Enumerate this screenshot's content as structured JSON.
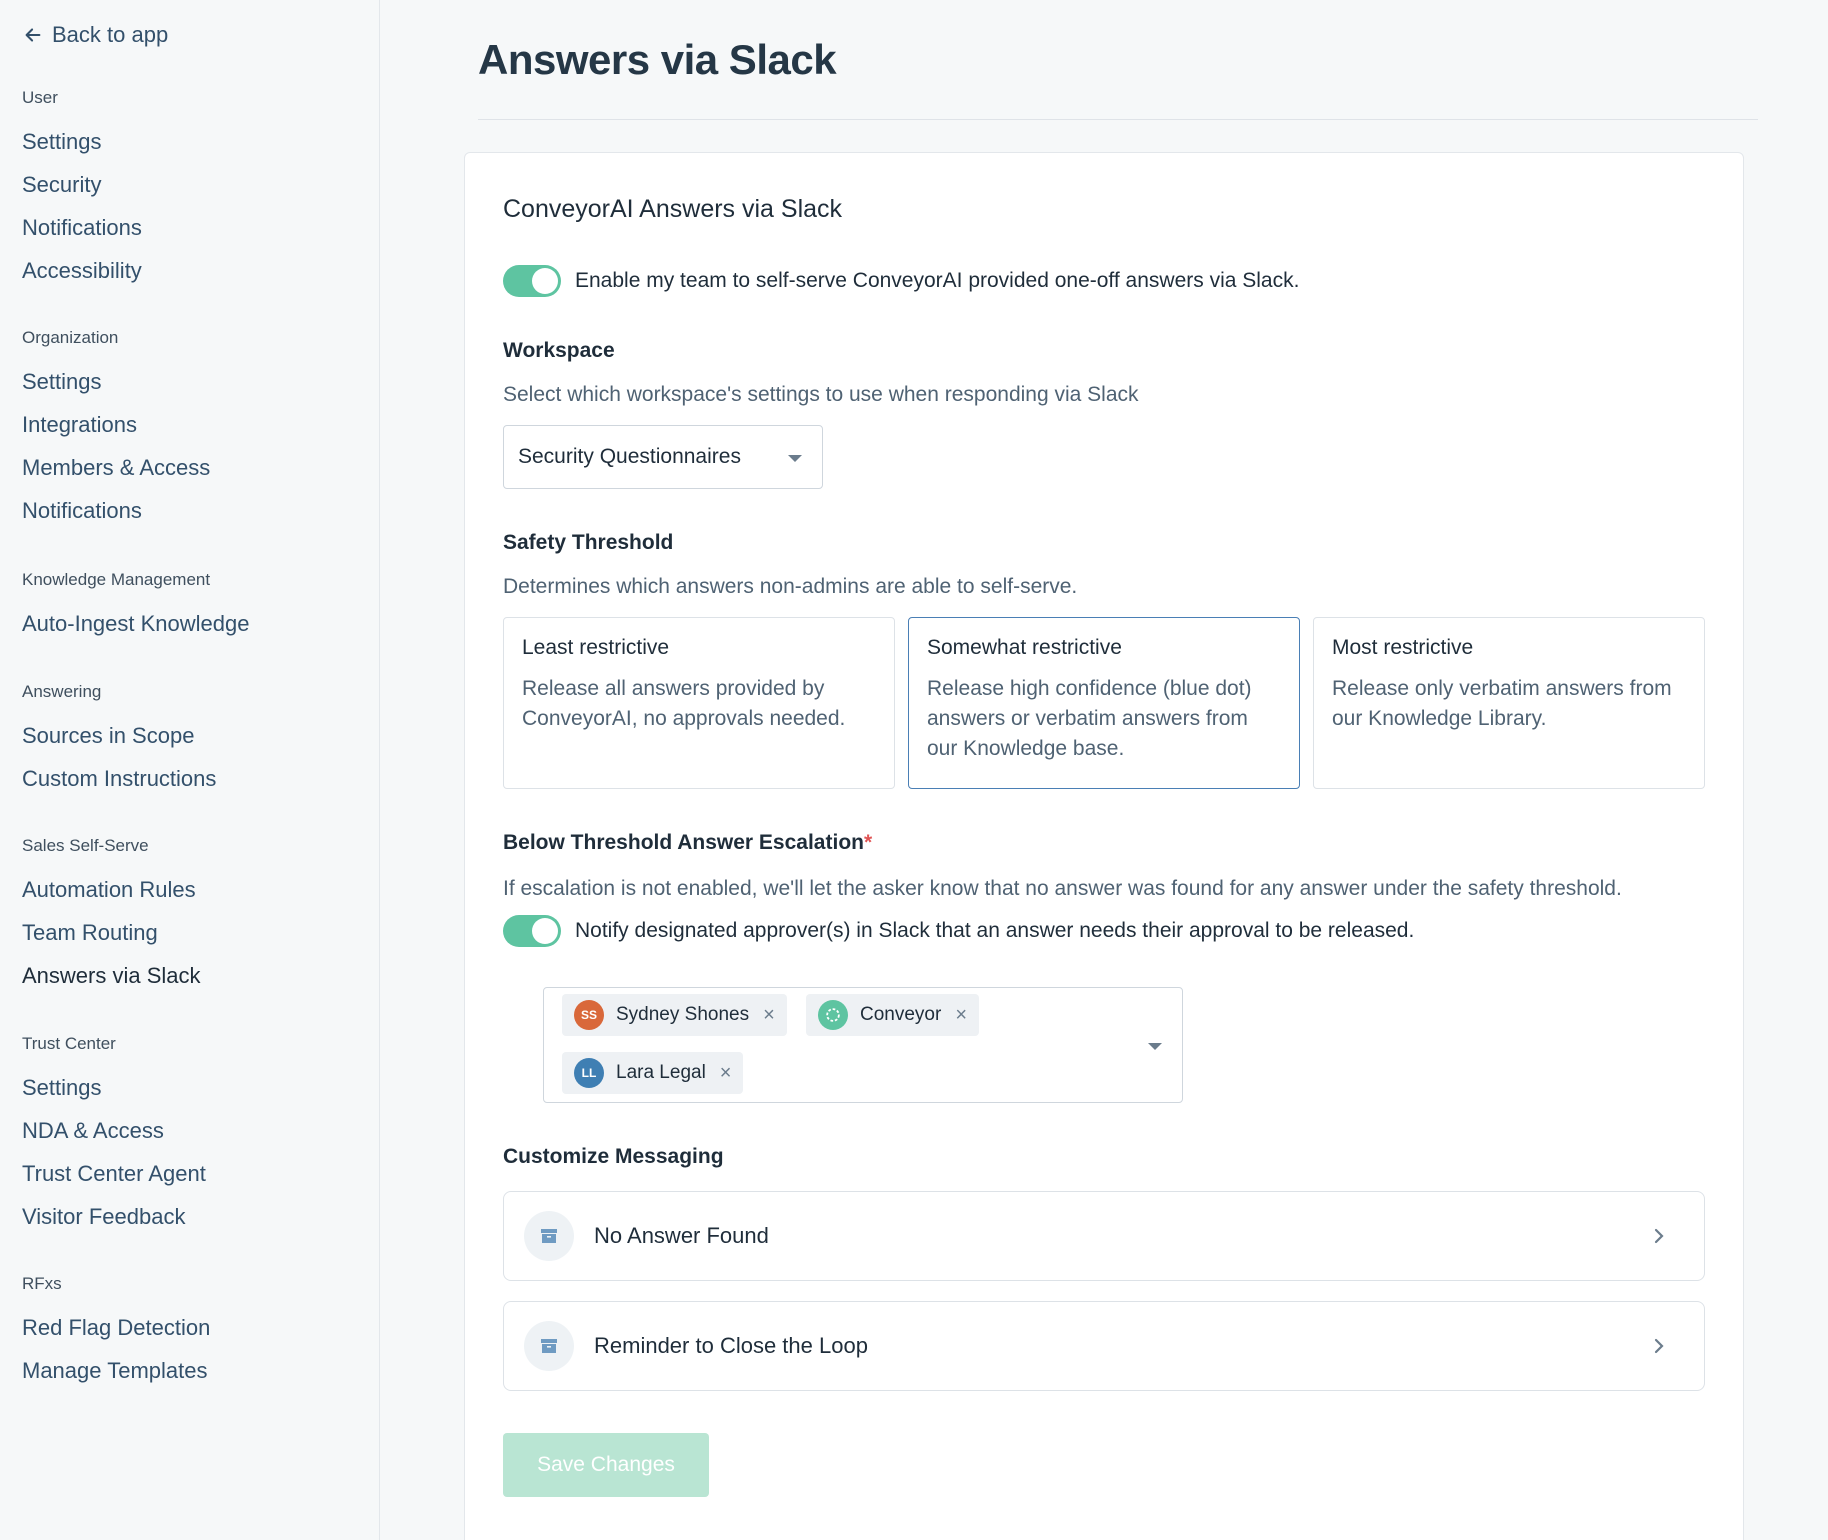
{
  "sidebar": {
    "back_label": "Back to app",
    "sections": [
      {
        "heading": "User",
        "items": [
          "Settings",
          "Security",
          "Notifications",
          "Accessibility"
        ]
      },
      {
        "heading": "Organization",
        "items": [
          "Settings",
          "Integrations",
          "Members & Access",
          "Notifications"
        ]
      },
      {
        "heading": "Knowledge Management",
        "items": [
          "Auto-Ingest Knowledge"
        ]
      },
      {
        "heading": "Answering",
        "items": [
          "Sources in Scope",
          "Custom Instructions"
        ]
      },
      {
        "heading": "Sales Self-Serve",
        "items": [
          "Automation Rules",
          "Team Routing",
          "Answers via Slack"
        ]
      },
      {
        "heading": "Trust Center",
        "items": [
          "Settings",
          "NDA & Access",
          "Trust Center Agent",
          "Visitor Feedback"
        ]
      },
      {
        "heading": "RFxs",
        "items": [
          "Red Flag Detection",
          "Manage Templates"
        ]
      }
    ],
    "active_item": "Answers via Slack"
  },
  "page": {
    "title": "Answers via Slack",
    "card_title": "ConveyorAI Answers via Slack",
    "enable_toggle": {
      "on": true,
      "label": "Enable my team to self-serve ConveyorAI provided one-off answers via Slack."
    },
    "workspace": {
      "title": "Workspace",
      "description": "Select which workspace's settings to use when responding via Slack",
      "selected": "Security Questionnaires"
    },
    "safety": {
      "title": "Safety Threshold",
      "description": "Determines which answers non-admins are able to self-serve.",
      "options": [
        {
          "title": "Least restrictive",
          "description": "Release all answers provided by ConveyorAI, no approvals needed.",
          "selected": false
        },
        {
          "title": "Somewhat restrictive",
          "description": "Release high confidence (blue dot) answers or verbatim answers from our Knowledge base.",
          "selected": true
        },
        {
          "title": "Most restrictive",
          "description": "Release only verbatim answers from our Knowledge Library.",
          "selected": false
        }
      ]
    },
    "escalation": {
      "title": "Below Threshold Answer Escalation",
      "required_mark": "*",
      "description": "If escalation is not enabled, we'll let the asker know that no answer was found for any answer under the safety threshold.",
      "toggle": {
        "on": true,
        "label": "Notify designated approver(s) in Slack that an answer needs their approval to be released."
      },
      "approvers": [
        {
          "initials": "SS",
          "name": "Sydney Shones",
          "color": "#d9683a"
        },
        {
          "initials": "",
          "name": "Conveyor",
          "color": "#5ec4a1"
        },
        {
          "initials": "LL",
          "name": "Lara Legal",
          "color": "#3f7fb3"
        }
      ],
      "remove_symbol": "×"
    },
    "messaging": {
      "title": "Customize Messaging",
      "items": [
        "No Answer Found",
        "Reminder to Close the Loop"
      ]
    },
    "save_label": "Save Changes"
  },
  "colors": {
    "accent_green": "#5ec4a1",
    "selected_border": "#4a7fb5",
    "highlight_outline": "#e84de8"
  }
}
